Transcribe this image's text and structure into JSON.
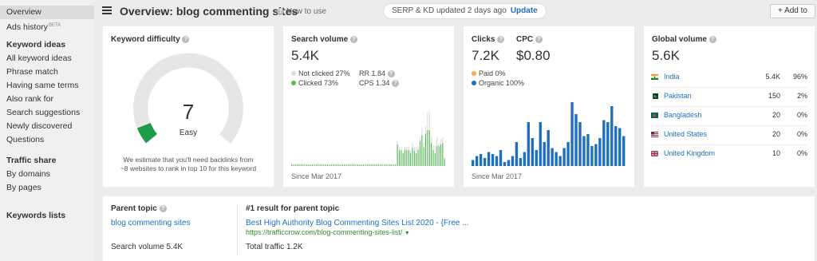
{
  "sidebar": {
    "overview": "Overview",
    "ads_history": "Ads history",
    "ads_badge": "BETA",
    "keyword_ideas_heading": "Keyword ideas",
    "keyword_ideas": [
      "All keyword ideas",
      "Phrase match",
      "Having same terms",
      "Also rank for",
      "Search suggestions",
      "Newly discovered",
      "Questions"
    ],
    "traffic_share_heading": "Traffic share",
    "traffic_share": [
      "By domains",
      "By pages"
    ],
    "keywords_lists": "Keywords lists"
  },
  "header": {
    "title": "Overview: blog commenting sites",
    "how_to_use": "How to use",
    "serp_status": "SERP & KD updated 2 days ago",
    "update": "Update",
    "add_to": "+ Add to"
  },
  "keyword_difficulty": {
    "title": "Keyword difficulty",
    "score": "7",
    "score_value": 7,
    "label": "Easy",
    "description_line1": "We estimate that you'll need backlinks from",
    "description_line2": "~8 websites to rank in top 10 for this keyword",
    "gauge_color": "#1e9b4b"
  },
  "search_volume": {
    "title": "Search volume",
    "value": "5.4K",
    "not_clicked": "Not clicked 27%",
    "clicked": "Clicked 73%",
    "rr": "RR 1.84",
    "cps": "CPS 1.34",
    "since": "Since Mar 2017",
    "clicked_color": "#5cb85c",
    "not_clicked_color": "#dddddd"
  },
  "clicks": {
    "title": "Clicks",
    "value": "7.2K",
    "cpc_title": "CPC",
    "cpc_value": "$0.80",
    "paid": "Paid 0%",
    "organic": "Organic 100%",
    "since": "Since Mar 2017",
    "paid_color": "#f0ad4e",
    "organic_color": "#1f6fbf"
  },
  "global_volume": {
    "title": "Global volume",
    "value": "5.6K",
    "countries": [
      {
        "name": "India",
        "volume": "5.4K",
        "share": "96%"
      },
      {
        "name": "Pakistan",
        "volume": "150",
        "share": "2%"
      },
      {
        "name": "Bangladesh",
        "volume": "20",
        "share": "0%"
      },
      {
        "name": "United States",
        "volume": "20",
        "share": "0%"
      },
      {
        "name": "United Kingdom",
        "volume": "10",
        "share": "0%"
      }
    ]
  },
  "parent_topic": {
    "title": "Parent topic",
    "topic": "blog commenting sites",
    "search_volume": "Search volume 5.4K",
    "first_result_title": "#1 result for parent topic",
    "result_title": "Best High Authority Blog Commenting Sites List 2020 - {Free ...",
    "result_url": "https://trafficcrow.com/blog-commenting-sites-list/",
    "total_traffic": "Total traffic 1.2K"
  },
  "chart_data": [
    {
      "type": "bar",
      "title": "Search volume",
      "series": [
        {
          "name": "Clicked",
          "values": [
            2,
            2,
            2,
            2,
            2,
            2,
            2,
            2,
            2,
            2,
            2,
            2,
            2,
            2,
            2,
            2,
            2,
            2,
            2,
            2,
            2,
            2,
            2,
            2,
            2,
            2,
            2,
            2,
            2,
            2,
            2,
            2,
            2,
            2,
            2,
            2,
            2,
            2,
            2,
            2,
            2,
            2,
            2,
            2,
            2,
            2,
            2,
            2,
            2,
            2,
            2,
            2,
            2,
            2,
            2,
            2,
            30,
            22,
            22,
            18,
            23,
            22,
            22,
            18,
            25,
            21,
            18,
            23,
            34,
            43,
            26,
            45,
            50,
            50,
            32,
            22,
            18,
            28,
            28,
            30,
            32,
            10
          ]
        },
        {
          "name": "Not clicked",
          "values": [
            1,
            1,
            1,
            1,
            1,
            1,
            1,
            1,
            1,
            1,
            1,
            1,
            1,
            1,
            1,
            1,
            1,
            1,
            1,
            1,
            1,
            1,
            1,
            1,
            1,
            1,
            1,
            1,
            1,
            1,
            1,
            1,
            1,
            1,
            1,
            1,
            1,
            1,
            1,
            1,
            1,
            1,
            1,
            1,
            1,
            1,
            1,
            1,
            1,
            1,
            1,
            1,
            1,
            1,
            1,
            1,
            5,
            5,
            5,
            3,
            4,
            5,
            5,
            4,
            7,
            6,
            8,
            5,
            7,
            10,
            7,
            10,
            25,
            27,
            8,
            7,
            10,
            12,
            5,
            7,
            8,
            2
          ]
        }
      ]
    },
    {
      "type": "bar",
      "title": "Clicks",
      "series": [
        {
          "name": "Organic",
          "values": [
            3,
            5,
            6,
            4,
            7,
            6,
            5,
            8,
            2,
            3,
            5,
            12,
            4,
            7,
            22,
            14,
            8,
            22,
            12,
            18,
            9,
            7,
            5,
            9,
            12,
            32,
            26,
            22,
            15,
            16,
            10,
            11,
            14,
            23,
            22,
            30,
            20,
            19,
            15
          ]
        }
      ]
    }
  ]
}
